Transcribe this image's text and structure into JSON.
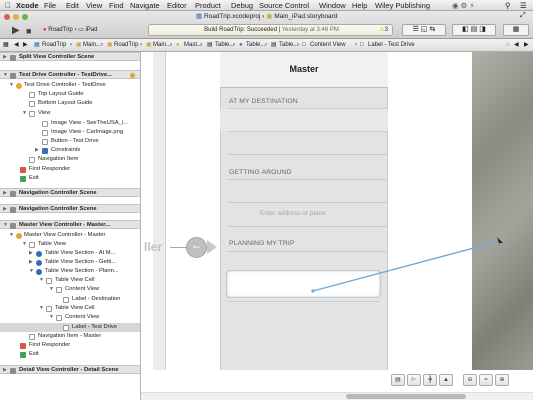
{
  "menubar": {
    "apple": "",
    "items": [
      "Xcode",
      "File",
      "Edit",
      "View",
      "Find",
      "Navigate",
      "Editor",
      "Product",
      "Debug",
      "Source Control",
      "Window",
      "Help",
      "Wiley Publishing"
    ]
  },
  "window": {
    "title_project": "RoadTrip.xcodeproj",
    "title_file": "Main_iPad.storyboard"
  },
  "toolbar": {
    "scheme": "RoadTrip",
    "device": "iPad",
    "status_main": "Build RoadTrip: Succeeded",
    "status_time": "Yesterday at 3:46 PM",
    "warning_count": "3"
  },
  "jumpbar": {
    "items": [
      "RoadTrip",
      "Main...",
      "RoadTrip",
      "Main...",
      "Mast...",
      "Table...",
      "Table...",
      "Table...",
      "Content View",
      "Label - Test Drive"
    ]
  },
  "outline": {
    "rows": [
      {
        "label": "Split View Controller Scene",
        "scene": true
      },
      {
        "label": "Test Drive Controller - TestDrive...",
        "scene": true
      },
      {
        "label": "Test Drive Controller - TestDrive",
        "scene": false
      },
      {
        "label": "Top Layout Guide",
        "scene": false
      },
      {
        "label": "Bottom Layout Guide",
        "scene": false
      },
      {
        "label": "View",
        "scene": false
      },
      {
        "label": "Image View - SeeTheUSA_i...",
        "scene": false
      },
      {
        "label": "Image View - CarImage.png",
        "scene": false
      },
      {
        "label": "Button - Test Drive",
        "scene": false
      },
      {
        "label": "Constraints",
        "scene": false
      },
      {
        "label": "Navigation Item",
        "scene": false
      },
      {
        "label": "First Responder",
        "scene": false
      },
      {
        "label": "Exit",
        "scene": false
      },
      {
        "label": "Navigation Controller Scene",
        "scene": true
      },
      {
        "label": "Navigation Controller Scene",
        "scene": true
      },
      {
        "label": "Master View Controller - Master...",
        "scene": true
      },
      {
        "label": "Master View Controller - Master",
        "scene": false
      },
      {
        "label": "Table View",
        "scene": false
      },
      {
        "label": "Table View Section - At M...",
        "scene": false
      },
      {
        "label": "Table View Section - Getti...",
        "scene": false
      },
      {
        "label": "Table View Section - Plann...",
        "scene": false
      },
      {
        "label": "Table View Cell",
        "scene": false
      },
      {
        "label": "Content View",
        "scene": false
      },
      {
        "label": "Label - Destination",
        "scene": false
      },
      {
        "label": "Table View Cell",
        "scene": false
      },
      {
        "label": "Content View",
        "scene": false
      },
      {
        "label": "Label - Test Drive",
        "scene": false
      },
      {
        "label": "Navigation Item - Master",
        "scene": false
      },
      {
        "label": "First Responder",
        "scene": false
      },
      {
        "label": "Exit",
        "scene": false
      },
      {
        "label": "Detail View Controller - Detail Scene",
        "scene": true
      }
    ]
  },
  "canvas": {
    "left_scene_text": "ller",
    "nav_title": "Master",
    "sections": [
      "AT MY DESTINATION",
      "GETTING AROUND",
      "PLANNING MY TRIP"
    ],
    "search_placeholder": "Enter address or place"
  },
  "colors": {
    "connection_line": "#6aa9dc",
    "selection": "#d6d6d6"
  }
}
